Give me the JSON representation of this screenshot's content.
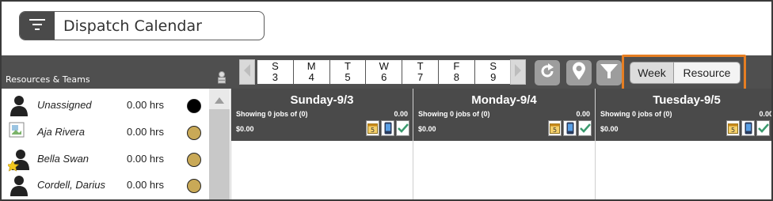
{
  "app": {
    "title": "Dispatch Calendar"
  },
  "sidebar": {
    "heading": "Resources & Teams",
    "resources": [
      {
        "name": "Unassigned",
        "hours": "0.00 hrs",
        "status_color": "#000000",
        "avatar": "person-silhouette-icon"
      },
      {
        "name": "Aja Rivera",
        "hours": "0.00 hrs",
        "status_color": "#c9a957",
        "avatar": "broken-image-icon"
      },
      {
        "name": "Bella Swan",
        "hours": "0.00 hrs",
        "status_color": "#c9a957",
        "avatar": "person-star-icon"
      },
      {
        "name": "Cordell, Darius",
        "hours": "0.00 hrs",
        "status_color": "#c9a957",
        "avatar": "person-silhouette-icon"
      }
    ]
  },
  "week_strip": {
    "days": [
      {
        "letter": "S",
        "num": "3"
      },
      {
        "letter": "M",
        "num": "4"
      },
      {
        "letter": "T",
        "num": "5"
      },
      {
        "letter": "W",
        "num": "6"
      },
      {
        "letter": "T",
        "num": "7"
      },
      {
        "letter": "F",
        "num": "8"
      },
      {
        "letter": "S",
        "num": "9"
      }
    ]
  },
  "toolbar": {
    "icons": [
      "refresh-icon",
      "map-pin-icon",
      "filter-icon"
    ]
  },
  "view_toggle": {
    "week_label": "Week",
    "resource_label": "Resource",
    "highlight_color": "#e67e22"
  },
  "calendar": {
    "columns": [
      {
        "title": "Sunday-9/3",
        "showing": "Showing 0 jobs of (0)",
        "total": "0.00",
        "amount": "$0.00"
      },
      {
        "title": "Monday-9/4",
        "showing": "Showing 0 jobs of (0)",
        "total": "0.00",
        "amount": "$0.00"
      },
      {
        "title": "Tuesday-9/5",
        "showing": "Showing 0 jobs of (0)",
        "total": "0.00",
        "amount": "$0.00"
      }
    ],
    "day_icons": [
      "calendar-5-icon",
      "mobile-phone-icon",
      "checkmark-icon"
    ]
  }
}
